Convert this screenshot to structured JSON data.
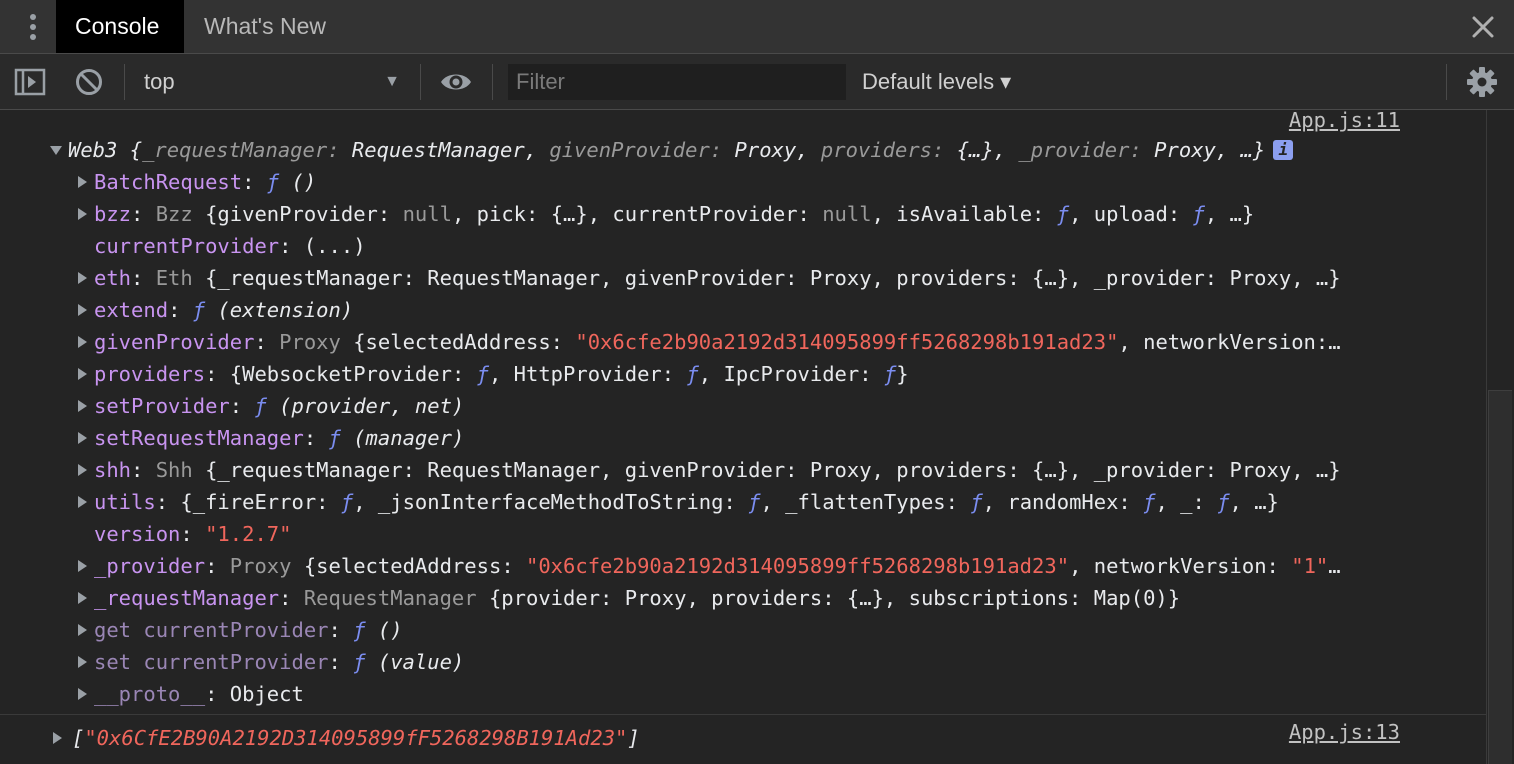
{
  "tabs": [
    {
      "label": "Console",
      "active": true
    },
    {
      "label": "What's New",
      "active": false
    }
  ],
  "toolbar": {
    "context": "top",
    "filter_placeholder": "Filter",
    "levels": "Default levels ▾"
  },
  "messages": [
    {
      "source": "App.js:11",
      "summary": {
        "prefix": "Web3 {",
        "parts": [
          {
            "k": "_requestManager",
            "v": "RequestManager"
          },
          {
            "k": "givenProvider",
            "v": "Proxy"
          },
          {
            "k": "providers",
            "v": "{…}"
          },
          {
            "k": "_provider",
            "v": "Proxy"
          }
        ],
        "suffix": ", …}"
      },
      "props": [
        {
          "key": "BatchRequest",
          "html": "<span class='f'>ƒ</span> <span class='it'>()</span>",
          "expand": true,
          "dim": false
        },
        {
          "key": "bzz",
          "html": "<span class='g'>Bzz</span> {givenProvider: <span class='g'>null</span>, pick: {…}, currentProvider: <span class='g'>null</span>, isAvailable: <span class='f'>ƒ</span>, upload: <span class='f'>ƒ</span>, …}",
          "expand": true,
          "dim": false
        },
        {
          "key": "currentProvider",
          "html": "(...)",
          "expand": false,
          "dim": false
        },
        {
          "key": "eth",
          "html": "<span class='g'>Eth</span> {_requestManager: RequestManager, givenProvider: Proxy, providers: {…}, _provider: Proxy, …}",
          "expand": true,
          "dim": false
        },
        {
          "key": "extend",
          "html": "<span class='f'>ƒ</span> <span class='it'>(extension)</span>",
          "expand": true,
          "dim": false
        },
        {
          "key": "givenProvider",
          "html": "<span class='g'>Proxy</span> {selectedAddress: <span class='s'>\"0x6cfe2b90a2192d314095899ff5268298b191ad23\"</span>, networkVersion:…",
          "expand": true,
          "dim": false
        },
        {
          "key": "providers",
          "html": "{WebsocketProvider: <span class='f'>ƒ</span>, HttpProvider: <span class='f'>ƒ</span>, IpcProvider: <span class='f'>ƒ</span>}",
          "expand": true,
          "dim": false
        },
        {
          "key": "setProvider",
          "html": "<span class='f'>ƒ</span> <span class='it'>(provider, net)</span>",
          "expand": true,
          "dim": false
        },
        {
          "key": "setRequestManager",
          "html": "<span class='f'>ƒ</span> <span class='it'>(manager)</span>",
          "expand": true,
          "dim": false
        },
        {
          "key": "shh",
          "html": "<span class='g'>Shh</span> {_requestManager: RequestManager, givenProvider: Proxy, providers: {…}, _provider: Proxy, …}",
          "expand": true,
          "dim": false
        },
        {
          "key": "utils",
          "html": "{_fireError: <span class='f'>ƒ</span>, _jsonInterfaceMethodToString: <span class='f'>ƒ</span>, _flattenTypes: <span class='f'>ƒ</span>, randomHex: <span class='f'>ƒ</span>, _: <span class='f'>ƒ</span>, …}",
          "expand": true,
          "dim": false
        },
        {
          "key": "version",
          "html": "<span class='s'>\"1.2.7\"</span>",
          "expand": false,
          "dim": false
        },
        {
          "key": "_provider",
          "html": "<span class='g'>Proxy</span> {selectedAddress: <span class='s'>\"0x6cfe2b90a2192d314095899ff5268298b191ad23\"</span>, networkVersion: <span class='s'>\"1\"</span>…",
          "expand": true,
          "dim": false
        },
        {
          "key": "_requestManager",
          "html": "<span class='g'>RequestManager</span> {provider: Proxy, providers: {…}, subscriptions: Map(0)}",
          "expand": true,
          "dim": false
        },
        {
          "key": "get currentProvider",
          "html": "<span class='f'>ƒ</span> <span class='it'>()</span>",
          "expand": true,
          "dim": true
        },
        {
          "key": "set currentProvider",
          "html": "<span class='f'>ƒ</span> <span class='it'>(value)</span>",
          "expand": true,
          "dim": true
        },
        {
          "key": "__proto__",
          "html": "Object",
          "expand": true,
          "dim": true
        }
      ]
    },
    {
      "source": "App.js:13",
      "text": "[\"0x6CfE2B90A2192D314095899fF5268298B191Ad23\"]"
    }
  ],
  "colors": {
    "key": "#c894f0",
    "function": "#7b8df0",
    "string": "#f0665c",
    "dim": "#9a9a9a"
  }
}
